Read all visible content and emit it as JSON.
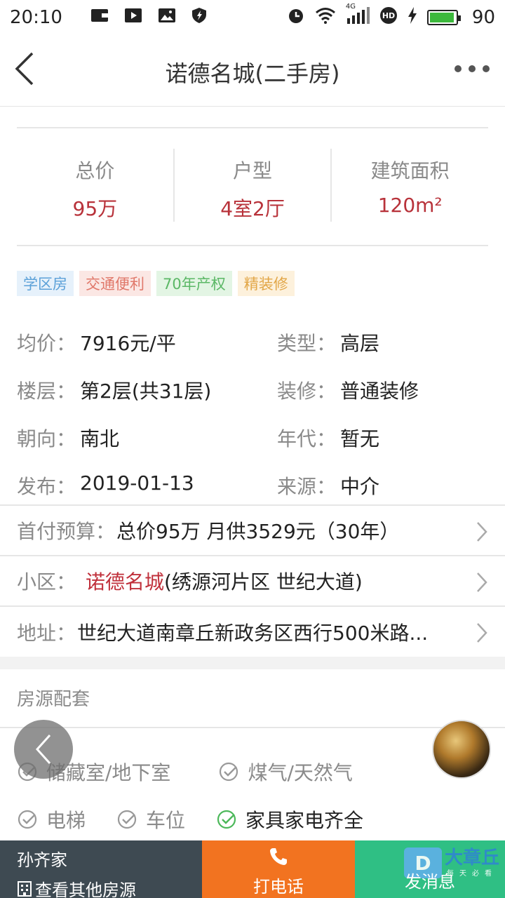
{
  "status_bar": {
    "time": "20:10",
    "network": "4G",
    "battery": "90"
  },
  "header": {
    "title": "诺德名城(二手房)"
  },
  "summary": [
    {
      "label": "总价",
      "value": "95万"
    },
    {
      "label": "户型",
      "value": "4室2厅"
    },
    {
      "label": "建筑面积",
      "value": "120m²"
    }
  ],
  "tags": [
    "学区房",
    "交通便利",
    "70年产权",
    "精装修"
  ],
  "details": [
    [
      {
        "label": "均价：",
        "value": "7916元/平"
      },
      {
        "label": "类型：",
        "value": "高层"
      }
    ],
    [
      {
        "label": "楼层：",
        "value": "第2层(共31层)"
      },
      {
        "label": "装修：",
        "value": "普通装修"
      }
    ],
    [
      {
        "label": "朝向：",
        "value": "南北"
      },
      {
        "label": "年代：",
        "value": "暂无"
      }
    ],
    [
      {
        "label": "发布：",
        "value": "2019-01-13"
      },
      {
        "label": "来源：",
        "value": "中介"
      }
    ]
  ],
  "links": {
    "budget": {
      "label": "首付预算：",
      "value": "总价95万 月供3529元（30年）"
    },
    "community": {
      "label": "小区：",
      "name": "诺德名城",
      "value": "(绣源河片区 世纪大道)"
    },
    "address": {
      "label": "地址：",
      "value": "世纪大道南章丘新政务区西行500米路..."
    }
  },
  "amenities": {
    "title": "房源配套",
    "items": [
      {
        "label": "储藏室/地下室",
        "checked": false
      },
      {
        "label": "煤气/天然气",
        "checked": false
      },
      {
        "label": "电梯",
        "checked": false
      },
      {
        "label": "车位",
        "checked": false
      },
      {
        "label": "家具家电齐全",
        "checked": true
      }
    ]
  },
  "bottom_bar": {
    "agent_name": "孙齐家",
    "other_listings": "查看其他房源",
    "call_label": "打电话",
    "message_label": "发消息"
  },
  "watermark": {
    "logo": "D",
    "text": "大章丘",
    "sub": "每天必看"
  },
  "colors": {
    "accent_red": "#b8323a",
    "call_orange": "#f27320",
    "msg_green": "#2fbf84",
    "agent_bg": "#3e4a52"
  }
}
